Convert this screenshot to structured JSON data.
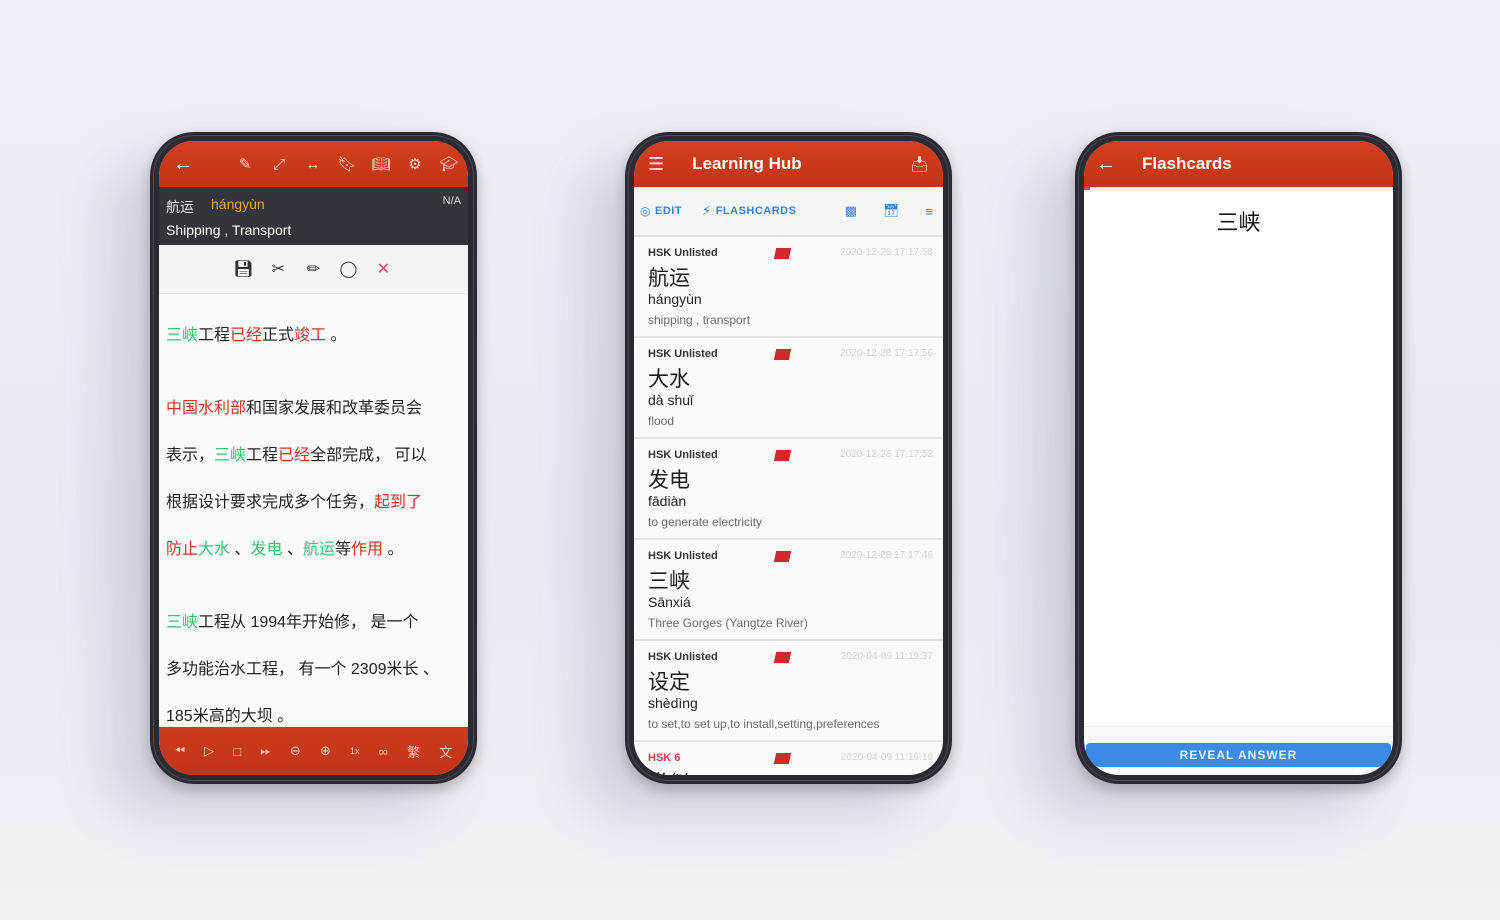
{
  "reader_screen": {
    "toolbar_icons": [
      "back-arrow-icon",
      "brush-icon",
      "expand-icon",
      "swap-horizontal-icon",
      "bookmark-icon",
      "book-open-icon",
      "settings-icon",
      "school-icon"
    ],
    "word_panel": {
      "hanzi": "航运",
      "pinyin": "hángyùn",
      "status": "N/A",
      "definition": "Shipping , Transport"
    },
    "edit_icons": [
      "save-icon",
      "scissors-icon",
      "pencil-icon",
      "ear-icon",
      "close-icon"
    ],
    "paragraphs": [
      {
        "segments": [
          {
            "t": "三峡",
            "c": "g"
          },
          {
            "t": "工程",
            "c": ""
          },
          {
            "t": "已经",
            "c": "r"
          },
          {
            "t": "正式",
            "c": ""
          },
          {
            "t": "竣工",
            "c": "r"
          },
          {
            "t": " 。",
            "c": ""
          }
        ]
      },
      {
        "gap": true,
        "segments": [
          {
            "t": "中国水利部",
            "c": "r"
          },
          {
            "t": "和国家发展和改革委员会",
            "c": ""
          }
        ]
      },
      {
        "segments": [
          {
            "t": "表示，",
            "c": ""
          },
          {
            "t": "三峡",
            "c": "g"
          },
          {
            "t": "工程",
            "c": ""
          },
          {
            "t": "已经",
            "c": "r"
          },
          {
            "t": "全部完成， 可以",
            "c": ""
          }
        ]
      },
      {
        "segments": [
          {
            "t": "根据设计要求完成多个任务，",
            "c": ""
          },
          {
            "t": "起到了",
            "c": "r"
          }
        ]
      },
      {
        "segments": [
          {
            "t": "防止",
            "c": "r"
          },
          {
            "t": "大水",
            "c": "g"
          },
          {
            "t": " 、",
            "c": ""
          },
          {
            "t": "发电",
            "c": "g"
          },
          {
            "t": " 、",
            "c": ""
          },
          {
            "t": "航运",
            "c": "g"
          },
          {
            "t": "等",
            "c": ""
          },
          {
            "t": "作用",
            "c": "r"
          },
          {
            "t": " 。",
            "c": ""
          }
        ]
      },
      {
        "gap": true,
        "segments": [
          {
            "t": "三峡",
            "c": "g"
          },
          {
            "t": "工程从 1994年开始修， 是一个",
            "c": ""
          }
        ]
      },
      {
        "segments": [
          {
            "t": "多功能治水工程， 有一个 2309米长 、",
            "c": ""
          }
        ]
      },
      {
        "segments": [
          {
            "t": " 185米高的大坝 。",
            "c": ""
          }
        ]
      }
    ],
    "player": {
      "speed_label": "1x",
      "icons": [
        "rewind-icon",
        "play-icon",
        "stop-icon",
        "fast-forward-icon",
        "zoom-out-icon",
        "zoom-in-icon",
        "speed-label",
        "glasses-icon",
        "traditional-chinese-icon",
        "translate-icon"
      ]
    }
  },
  "hub_screen": {
    "title": "Learning Hub",
    "actions": {
      "edit_label": "EDIT",
      "flashcards_label": "FLASHCARDS"
    },
    "items": [
      {
        "level": "HSK Unlisted",
        "hanzi": "航运",
        "pinyin": "hángyùn",
        "definition": "shipping , transport",
        "timestamp": "2020-12-28 17:17:58"
      },
      {
        "level": "HSK Unlisted",
        "hanzi": "大水",
        "pinyin": "dà shuǐ",
        "definition": "flood",
        "timestamp": "2020-12-28 17:17:56"
      },
      {
        "level": "HSK Unlisted",
        "hanzi": "发电",
        "pinyin": "fādiàn",
        "definition": "to generate electricity",
        "timestamp": "2020-12-28 17:17:52"
      },
      {
        "level": "HSK Unlisted",
        "hanzi": "三峡",
        "pinyin": "Sānxiá",
        "definition": "Three Gorges (Yangtze River)",
        "timestamp": "2020-12-28 17:17:46"
      },
      {
        "level": "HSK Unlisted",
        "hanzi": "设定",
        "pinyin": "shèdìng",
        "definition": "to set,to set up,to install,setting,preferences",
        "timestamp": "2020-04-09 11:19:37"
      },
      {
        "level": "HSK 6",
        "hanzi": "类似",
        "pinyin": "",
        "definition": "",
        "timestamp": "2020-04-09 11:16:18"
      }
    ]
  },
  "flashcard_screen": {
    "title": "Flashcards",
    "progress_percent": 2,
    "card_word": "三峡",
    "reveal_label": "REVEAL ANSWER"
  },
  "colors": {
    "brand_red": "#c93617",
    "accent_blue": "#3d7fd6",
    "highlight_green": "#3fbf73",
    "highlight_red": "#c9382c"
  }
}
